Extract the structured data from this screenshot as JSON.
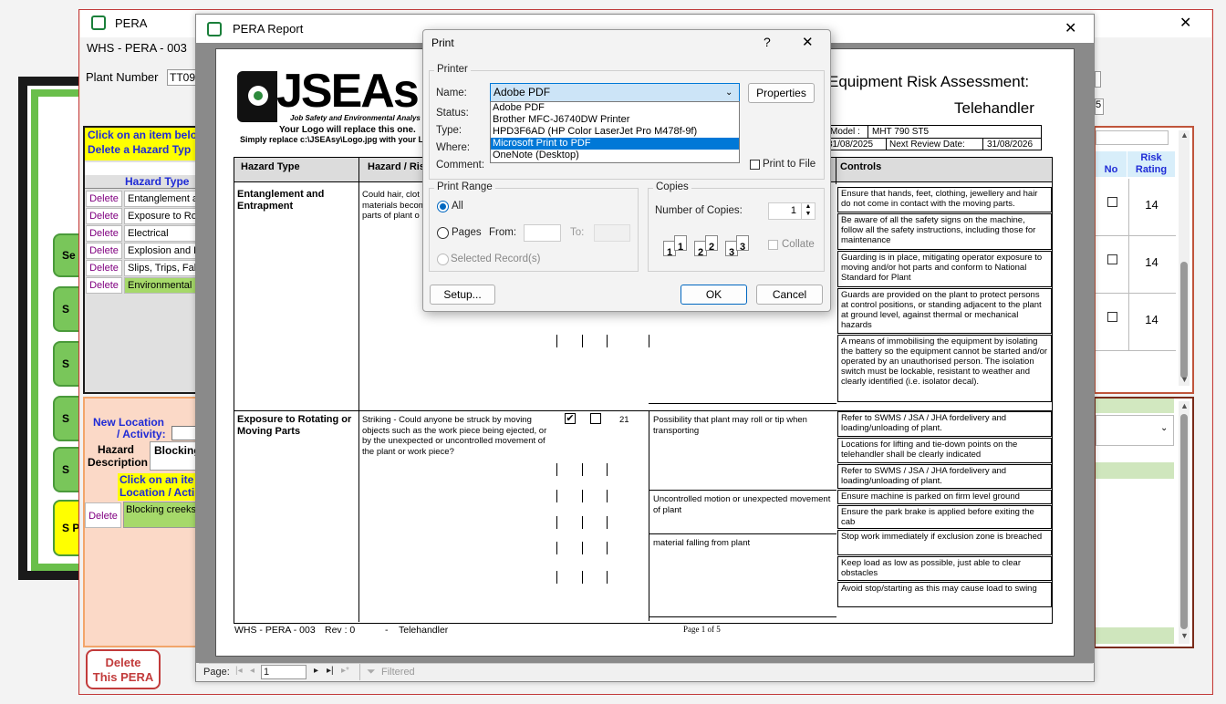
{
  "pera_window": {
    "title": "PERA",
    "close": "✕",
    "doc_code": "WHS - PERA - 003",
    "plant_number_label": "Plant Number",
    "plant_number_value": "TT09",
    "note_line1": "Click on an item belo",
    "note_line2": "Delete a Hazard Typ",
    "hazard_type_header": "Hazard Type",
    "hazard_rows": [
      {
        "delete": "Delete",
        "name": "Entanglement a"
      },
      {
        "delete": "Delete",
        "name": "Exposure to Ro"
      },
      {
        "delete": "Delete",
        "name": "Electrical"
      },
      {
        "delete": "Delete",
        "name": "Explosion and F"
      },
      {
        "delete": "Delete",
        "name": "Slips, Trips, Fal"
      },
      {
        "delete": "Delete",
        "name": "Environmental"
      }
    ],
    "new_location_label": "New Location",
    "activity_label": "/ Activity:",
    "hazard_label": "Hazard",
    "description_label": "Description",
    "blocking_value": "Blocking",
    "click_item_note1": "Click on an ite",
    "click_item_note2": "Location / Acti",
    "location_delete": "Delete",
    "location_row": "Blocking creeks c",
    "delete_pera_line1": "Delete",
    "delete_pera_line2": "This PERA",
    "side_buttons": [
      "Se",
      "S",
      "S",
      "S",
      "S",
      "S Pl"
    ],
    "risk_header_no": "No",
    "risk_header_rating_1": "Risk",
    "risk_header_rating_2": "Rating",
    "risk_values": [
      "14",
      "14",
      "14"
    ],
    "side_digit": "5"
  },
  "report_window": {
    "title": "PERA Report",
    "close": "✕",
    "logo_text": "JSEAs",
    "logo_sub": "Job Safety and Environmental Analys",
    "logo_note1": "Your Logo will replace this one.",
    "logo_note2": "Simply replace c:\\JSEAsy\\Logo.jpg with your L",
    "report_title_1": "Equipment Risk Assessment:",
    "report_title_2": "Telehandler",
    "model_label": "Model :",
    "model_value": "MHT 790 ST5",
    "date_value": "31/08/2025",
    "next_review_label": "Next Review Date:",
    "next_review_value": "31/08/2026",
    "col_hazard_type": "Hazard Type",
    "col_hazard_risk": "Hazard / Ris",
    "col_controls": "Controls",
    "sections": [
      {
        "type": "Entanglement and Entrapment",
        "description": "Could hair, clot materials becom parts of plant o",
        "controls": [
          "Ensure that hands, feet, clothing, jewellery and hair do not come in contact with the moving parts.",
          "Be aware of all the safety signs on the machine, follow all the safety instructions, including those for maintenance",
          "Guarding is in place, mitigating operator exposure to moving and/or hot parts and conform to National Standard for Plant",
          "Guards are provided on the plant to protect persons at control positions, or standing adjacent to the plant at ground level, against thermal or mechanical hazards",
          "A means of immobilising the equipment by isolating the battery so the equipment cannot be started and/or operated by an unauthorised person. The isolation switch must be lockable, resistant to weather and clearly identified (i.e. isolator decal)."
        ]
      },
      {
        "type": "Exposure to Rotating or Moving Parts",
        "description": "Striking - Could anyone be struck by moving objects such as the work piece being ejected, or by the unexpected or uncontrolled movement of the plant or work piece?",
        "score": "21",
        "risks": [
          "Possibility that plant may roll or tip when transporting",
          "Uncontrolled motion or unexpected movement of plant",
          "material falling from plant"
        ],
        "controls": [
          "Refer to SWMS / JSA / JHA fordelivery and loading/unloading of plant.",
          "Locations for lifting and tie-down points on the telehandler shall be clearly indicated",
          "Refer to SWMS / JSA / JHA fordelivery and loading/unloading of plant.",
          "Ensure machine is parked on firm level ground",
          "Ensure the park brake is applied before exiting the cab",
          "Stop work immediately if exclusion zone is breached",
          "Keep load as low as possible, just able to clear obstacles",
          "Avoid stop/starting as this may cause load to swing"
        ]
      }
    ],
    "footer_code": "WHS - PERA - 003",
    "footer_rev": "Rev : 0",
    "footer_dash": "-",
    "footer_name": "Telehandler",
    "footer_page": "Page 1 of 5",
    "nav_page_label": "Page:",
    "nav_page_value": "1",
    "nav_filter": "Filtered"
  },
  "print_dialog": {
    "title": "Print",
    "help": "?",
    "close": "✕",
    "printer_group": "Printer",
    "name_label": "Name:",
    "name_value": "Adobe PDF",
    "properties_button": "Properties",
    "status_label": "Status:",
    "type_label": "Type:",
    "where_label": "Where:",
    "comment_label": "Comment:",
    "print_to_file": "Print to File",
    "printer_options": [
      "Adobe PDF",
      "Brother MFC-J6740DW Printer",
      "HPD3F6AD (HP Color LaserJet Pro M478f-9f)",
      "Microsoft Print to PDF",
      "OneNote (Desktop)"
    ],
    "highlighted_option": "Microsoft Print to PDF",
    "print_range_group": "Print Range",
    "range_all": "All",
    "range_pages": "Pages",
    "from_label": "From:",
    "to_label": "To:",
    "selected_records": "Selected Record(s)",
    "copies_group": "Copies",
    "number_of_copies_label": "Number of Copies:",
    "number_of_copies_value": "1",
    "collate": "Collate",
    "setup_button": "Setup...",
    "ok_button": "OK",
    "cancel_button": "Cancel"
  }
}
